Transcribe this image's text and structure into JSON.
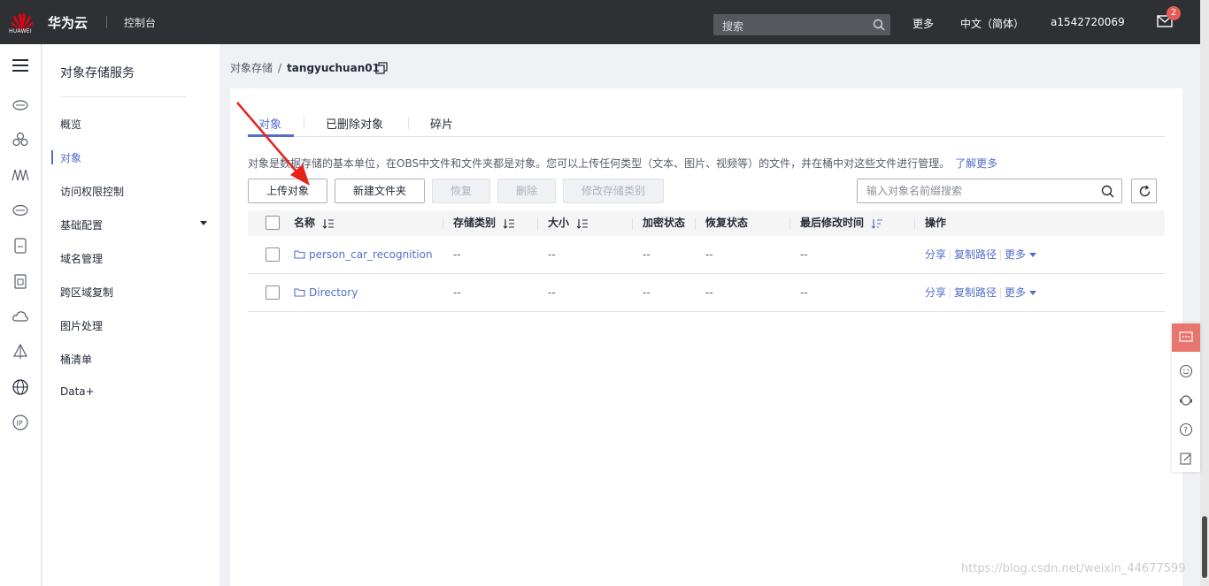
{
  "topbar": {
    "logo_text": "HUAWEI",
    "brand": "华为云",
    "console": "控制台",
    "search_placeholder": "搜索",
    "more": "更多",
    "language": "中文（简体）",
    "username": "a1542720069",
    "mail_count": "2"
  },
  "service_nav": {
    "title": "对象存储服务",
    "items": [
      {
        "label": "概览"
      },
      {
        "label": "对象"
      },
      {
        "label": "访问权限控制"
      },
      {
        "label": "基础配置"
      },
      {
        "label": "域名管理"
      },
      {
        "label": "跨区域复制"
      },
      {
        "label": "图片处理"
      },
      {
        "label": "桶清单"
      },
      {
        "label": "Data+"
      }
    ]
  },
  "breadcrumb": {
    "parent": "对象存储",
    "separator": "/",
    "current": "tangyuchuan01"
  },
  "tabs": [
    {
      "label": "对象"
    },
    {
      "label": "已删除对象"
    },
    {
      "label": "碎片"
    }
  ],
  "description": {
    "text": "对象是数据存储的基本单位，在OBS中文件和文件夹都是对象。您可以上传任何类型（文本、图片、视频等）的文件，并在桶中对这些文件进行管理。",
    "link": "了解更多"
  },
  "toolbar": {
    "upload": "上传对象",
    "new_folder": "新建文件夹",
    "restore": "恢复",
    "delete": "删除",
    "change_storage": "修改存储类别",
    "search_placeholder": "输入对象名前缀搜索"
  },
  "table": {
    "columns": [
      "名称",
      "存储类别",
      "大小",
      "加密状态",
      "恢复状态",
      "最后修改时间",
      "操作"
    ],
    "rows": [
      {
        "name": "person_car_recognition",
        "storage": "--",
        "size": "--",
        "encryption": "--",
        "restore": "--",
        "modified": "--"
      },
      {
        "name": "Directory",
        "storage": "--",
        "size": "--",
        "encryption": "--",
        "restore": "--",
        "modified": "--"
      }
    ],
    "actions": {
      "share": "分享",
      "copy_path": "复制路径",
      "more": "更多"
    }
  },
  "watermark": "https://blog.csdn.net/weixin_44677599",
  "colors": {
    "topbar": "#2e3033",
    "accent": "#526ecc",
    "float_highlight": "#e8766e",
    "arrow": "#e5231b"
  }
}
